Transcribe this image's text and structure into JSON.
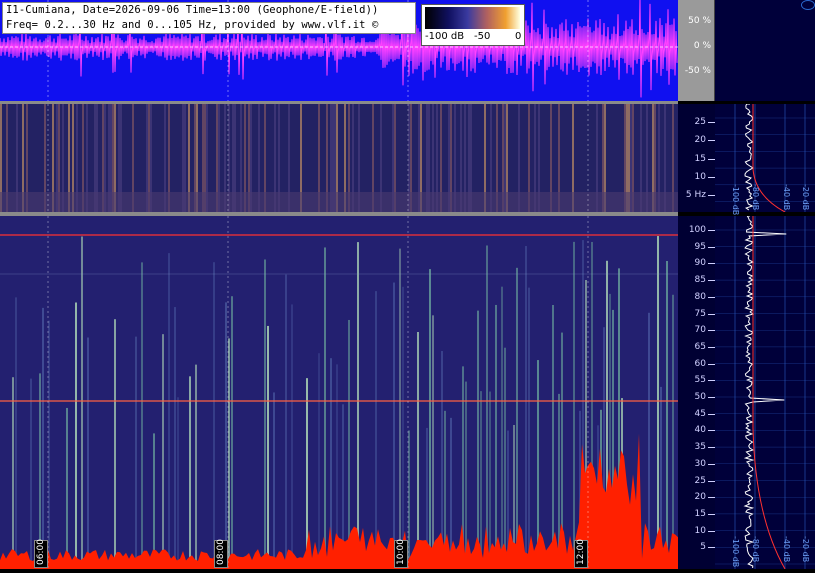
{
  "header": {
    "line1": "I1-Cumiana, Date=2026-09-06 Time=13:00 (Geophone/E-field))",
    "line2": "Freq= 0.2...30 Hz and 0...105 Hz, provided by www.vlf.it ©"
  },
  "color_scale": {
    "labels": [
      "-100 dB",
      "-50",
      "0"
    ]
  },
  "waveform_scale": [
    "50 %",
    "0 %",
    "-50 %"
  ],
  "spectrogram_low": {
    "freq_ticks": [
      "25",
      "20",
      "15",
      "10",
      "5 Hz"
    ]
  },
  "spectrogram_high": {
    "freq_ticks": [
      "100",
      "95",
      "90",
      "85",
      "80",
      "75",
      "70",
      "65",
      "60",
      "55",
      "50",
      "45",
      "40",
      "35",
      "30",
      "25",
      "20",
      "15",
      "10",
      "5"
    ]
  },
  "time_labels": [
    "06:00",
    "08:00",
    "10:00",
    "12:00"
  ],
  "profile_labels_low": [
    "-100 dB",
    "-80 dB",
    "-40 dB",
    "-20 dB"
  ],
  "profile_labels_high": [
    "-100 dB",
    "-80 dB",
    "-40 dB",
    "-20 dB"
  ],
  "colors": {
    "waveform_bg": "#1010f0",
    "waveform_trace": "#ff40ff",
    "spectrogram_bg": "#232070",
    "hot": "#ff2000",
    "axis_bg": "#000033",
    "profile_line": "#ffffff",
    "reference_line": "#ff3030"
  }
}
